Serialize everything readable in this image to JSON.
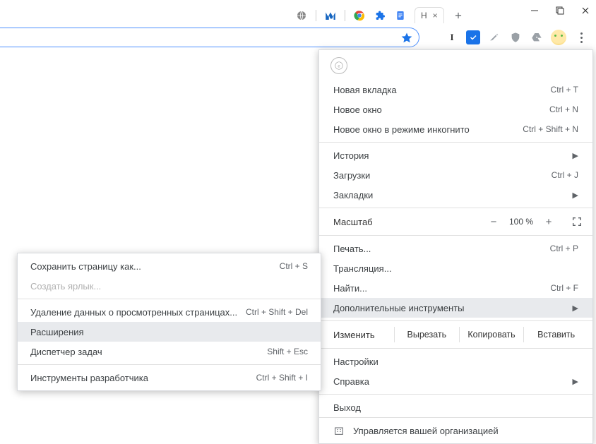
{
  "window": {
    "min": "—",
    "max": "▢",
    "close": "✕"
  },
  "tabstrip": {
    "active_tab_hint": "Н",
    "newtab_plus": "+"
  },
  "toolbar": {
    "letter_ext": "I"
  },
  "menu": {
    "new_tab": {
      "label": "Новая вкладка",
      "shortcut": "Ctrl + T"
    },
    "new_window": {
      "label": "Новое окно",
      "shortcut": "Ctrl + N"
    },
    "incognito": {
      "label": "Новое окно в режиме инкогнито",
      "shortcut": "Ctrl + Shift + N"
    },
    "history": {
      "label": "История"
    },
    "downloads": {
      "label": "Загрузки",
      "shortcut": "Ctrl + J"
    },
    "bookmarks": {
      "label": "Закладки"
    },
    "zoom": {
      "label": "Масштаб",
      "value": "100 %",
      "minus": "−",
      "plus": "+"
    },
    "print": {
      "label": "Печать...",
      "shortcut": "Ctrl + P"
    },
    "cast": {
      "label": "Трансляция..."
    },
    "find": {
      "label": "Найти...",
      "shortcut": "Ctrl + F"
    },
    "more_tools": {
      "label": "Дополнительные инструменты"
    },
    "edit": {
      "label": "Изменить",
      "cut": "Вырезать",
      "copy": "Копировать",
      "paste": "Вставить"
    },
    "settings": {
      "label": "Настройки"
    },
    "help": {
      "label": "Справка"
    },
    "exit": {
      "label": "Выход"
    },
    "managed": {
      "label": "Управляется вашей организацией"
    }
  },
  "submenu": {
    "save_page": {
      "label": "Сохранить страницу как...",
      "shortcut": "Ctrl + S"
    },
    "create_shortcut": {
      "label": "Создать ярлык..."
    },
    "clear_data": {
      "label": "Удаление данных о просмотренных страницах...",
      "shortcut": "Ctrl + Shift + Del"
    },
    "extensions": {
      "label": "Расширения"
    },
    "task_manager": {
      "label": "Диспетчер задач",
      "shortcut": "Shift + Esc"
    },
    "dev_tools": {
      "label": "Инструменты разработчика",
      "shortcut": "Ctrl + Shift + I"
    }
  }
}
